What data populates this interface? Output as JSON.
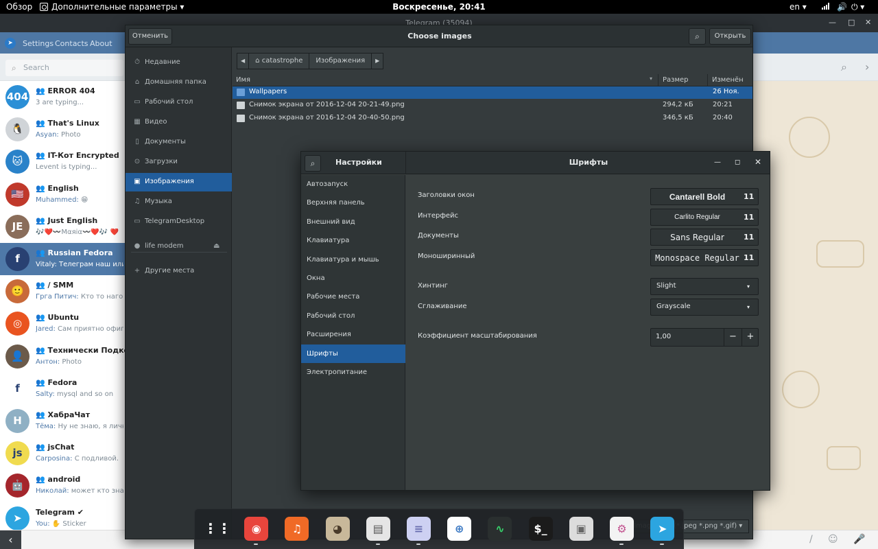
{
  "topbar": {
    "overview": "Обзор",
    "app_menu": "Дополнительные параметры ▾",
    "clock": "Воскресенье, 20:41",
    "lang": "en ▾",
    "net_icon": "network-icon",
    "volume": "🔊",
    "power": "⏻ ▾"
  },
  "telegram": {
    "title": "Telegram (35094)",
    "window_controls": {
      "minimize": "—",
      "maximize": "□",
      "close": "✕"
    },
    "menu": [
      "Settings",
      "Contacts",
      "About"
    ],
    "search_placeholder": "Search",
    "search_icon": "⌕",
    "header_icons": {
      "search": "⌕",
      "more": "›"
    },
    "chats": [
      {
        "name": "👥 ERROR 404",
        "preview": "3 are typing...",
        "sender": "",
        "avatar": "404",
        "color": "#2b8fd6"
      },
      {
        "name": "👥 That's Linux",
        "preview": "Photo",
        "sender": "Asyan: ",
        "avatar": "🐧",
        "color": "#d0d4d8"
      },
      {
        "name": "👥 IT-Кот Encrypted",
        "preview": "Levent is typing...",
        "sender": "",
        "avatar": "🐱",
        "color": "#2a82c9"
      },
      {
        "name": "👥 English",
        "preview": "😁",
        "sender": "Muhammed: ",
        "avatar": "🇺🇸",
        "color": "#c0392b"
      },
      {
        "name": "👥 Just English",
        "preview": "🎶❤️〰️Mαяiα〰️❤️🎶 ❤️",
        "sender": "",
        "avatar": "JE",
        "color": "#8a6d5a"
      },
      {
        "name": "👥 Russian Fedora",
        "preview": "Vitaly: Телеграм наш или д",
        "sender": "",
        "avatar": "f",
        "color": "#294172"
      },
      {
        "name": "👥 / SMM",
        "preview": "Кто то нагонит",
        "sender": "Грга Питич: ",
        "avatar": "🙂",
        "color": "#c86a3a"
      },
      {
        "name": "👥 Ubuntu",
        "preview": "Сам приятно офигев",
        "sender": "Jared: ",
        "avatar": "◎",
        "color": "#e95420"
      },
      {
        "name": "👥 Технически Подкованн",
        "preview": "Photo",
        "sender": "Антон: ",
        "avatar": "👤",
        "color": "#6b5a4a"
      },
      {
        "name": "👥 Fedora",
        "preview": "mysql and so on",
        "sender": "Salty: ",
        "avatar": "f",
        "color": "#ffffff"
      },
      {
        "name": "👥 ХабраЧат",
        "preview": "Ну не знаю, я лично",
        "sender": "Тёма: ",
        "avatar": "H",
        "color": "#8fb0c4"
      },
      {
        "name": "👥 jsChat",
        "preview": "С подливой.",
        "sender": "Carposina: ",
        "avatar": "js",
        "color": "#f0db4f"
      },
      {
        "name": "👥 android",
        "preview": "может кто знает?",
        "sender": "Николай: ",
        "avatar": "🤖",
        "color": "#a4262c"
      },
      {
        "name": "Telegram ✔",
        "preview": "✋ Sticker",
        "sender": "You: ",
        "avatar": "➤",
        "color": "#2ca5e0"
      }
    ],
    "bottom_back": "‹",
    "bottom_icons": [
      "/",
      "☺",
      "🎤"
    ]
  },
  "filechooser": {
    "title": "Choose images",
    "cancel": "Отменить",
    "open": "Открыть",
    "search_icon": "⌕",
    "places": [
      {
        "icon": "⏱",
        "label": "Недавние"
      },
      {
        "icon": "⌂",
        "label": "Домашняя папка"
      },
      {
        "icon": "▭",
        "label": "Рабочий стол"
      },
      {
        "icon": "▦",
        "label": "Видео"
      },
      {
        "icon": "▯",
        "label": "Документы"
      },
      {
        "icon": "⊙",
        "label": "Загрузки"
      },
      {
        "icon": "▣",
        "label": "Изображения"
      },
      {
        "icon": "♫",
        "label": "Музыка"
      },
      {
        "icon": "▭",
        "label": "TelegramDesktop"
      },
      {
        "icon": "●",
        "label": "life modem"
      },
      {
        "icon": "+",
        "label": "Другие места"
      }
    ],
    "eject_icon": "⏏",
    "crumbs": {
      "back": "◀",
      "home_icon": "⌂",
      "home": "catastrophe",
      "current": "Изображения",
      "forward": "▶"
    },
    "columns": {
      "name": "Имя",
      "sort": "▾",
      "size": "Размер",
      "modified": "Изменён"
    },
    "files": [
      {
        "type": "folder",
        "name": "Wallpapers",
        "size": "",
        "modified": "26 Ноя."
      },
      {
        "type": "image",
        "name": "Снимок экрана от 2016-12-04 20-21-49.png",
        "size": "294,2 кБ",
        "modified": "20:21"
      },
      {
        "type": "image",
        "name": "Снимок экрана от 2016-12-04 20-40-50.png",
        "size": "346,5 кБ",
        "modified": "20:40"
      }
    ],
    "filter": "Image files (*.jpeg *.png *.gif) ▾"
  },
  "tweaks": {
    "sidebar_title": "Настройки",
    "title": "Шрифты",
    "search_icon": "⌕",
    "controls": {
      "minimize": "—",
      "maximize": "◻",
      "close": "✕"
    },
    "categories": [
      "Автозапуск",
      "Верхняя панель",
      "Внешний вид",
      "Клавиатура",
      "Клавиатура и мышь",
      "Окна",
      "Рабочие места",
      "Рабочий стол",
      "Расширения",
      "Шрифты",
      "Электропитание"
    ],
    "fonts": {
      "titles": {
        "label": "Заголовки окон",
        "font": "Cantarell Bold",
        "size": "11"
      },
      "interface": {
        "label": "Интерфейс",
        "font": "Carlito Regular",
        "size": "11"
      },
      "documents": {
        "label": "Документы",
        "font": "Sans Regular",
        "size": "11"
      },
      "monospace": {
        "label": "Моноширинный",
        "font": "Monospace Regular",
        "size": "11"
      }
    },
    "hinting": {
      "label": "Хинтинг",
      "value": "Slight"
    },
    "antialiasing": {
      "label": "Сглаживание",
      "value": "Grayscale"
    },
    "scaling": {
      "label": "Коэффициент масштабирования",
      "value": "1,00",
      "minus": "−",
      "plus": "+"
    },
    "combo_arrow": "▾"
  },
  "dock": {
    "apps": [
      {
        "name": "apps-grid-icon",
        "glyph": "⋮⋮",
        "bg": "transparent",
        "fg": "#ffffff",
        "running": false
      },
      {
        "name": "chrome-icon",
        "glyph": "◉",
        "bg": "#e8453c",
        "fg": "#ffffff",
        "running": true
      },
      {
        "name": "music-icon",
        "glyph": "♫",
        "bg": "#f06a26",
        "fg": "#ffffff",
        "running": false
      },
      {
        "name": "gimp-icon",
        "glyph": "◕",
        "bg": "#c8b89a",
        "fg": "#4a3b2a",
        "running": false
      },
      {
        "name": "files-icon",
        "glyph": "▤",
        "bg": "#e5e5e5",
        "fg": "#555555",
        "running": true
      },
      {
        "name": "text-editor-icon",
        "glyph": "≡",
        "bg": "#cdd0f2",
        "fg": "#6a6fb0",
        "running": true
      },
      {
        "name": "web-icon",
        "glyph": "⊕",
        "bg": "#ffffff",
        "fg": "#3a78c3",
        "running": false
      },
      {
        "name": "system-monitor-icon",
        "glyph": "∿",
        "bg": "#2a2f2f",
        "fg": "#37d36b",
        "running": false
      },
      {
        "name": "terminal-icon",
        "glyph": "$_",
        "bg": "#1b1b1b",
        "fg": "#ffffff",
        "running": false
      },
      {
        "name": "disks-icon",
        "glyph": "▣",
        "bg": "#dcdcdc",
        "fg": "#666666",
        "running": false
      },
      {
        "name": "tweaks-icon",
        "glyph": "⚙",
        "bg": "#f3f3f3",
        "fg": "#c2528f",
        "running": true
      },
      {
        "name": "telegram-icon",
        "glyph": "➤",
        "bg": "#2ca5e0",
        "fg": "#ffffff",
        "running": true
      }
    ]
  }
}
